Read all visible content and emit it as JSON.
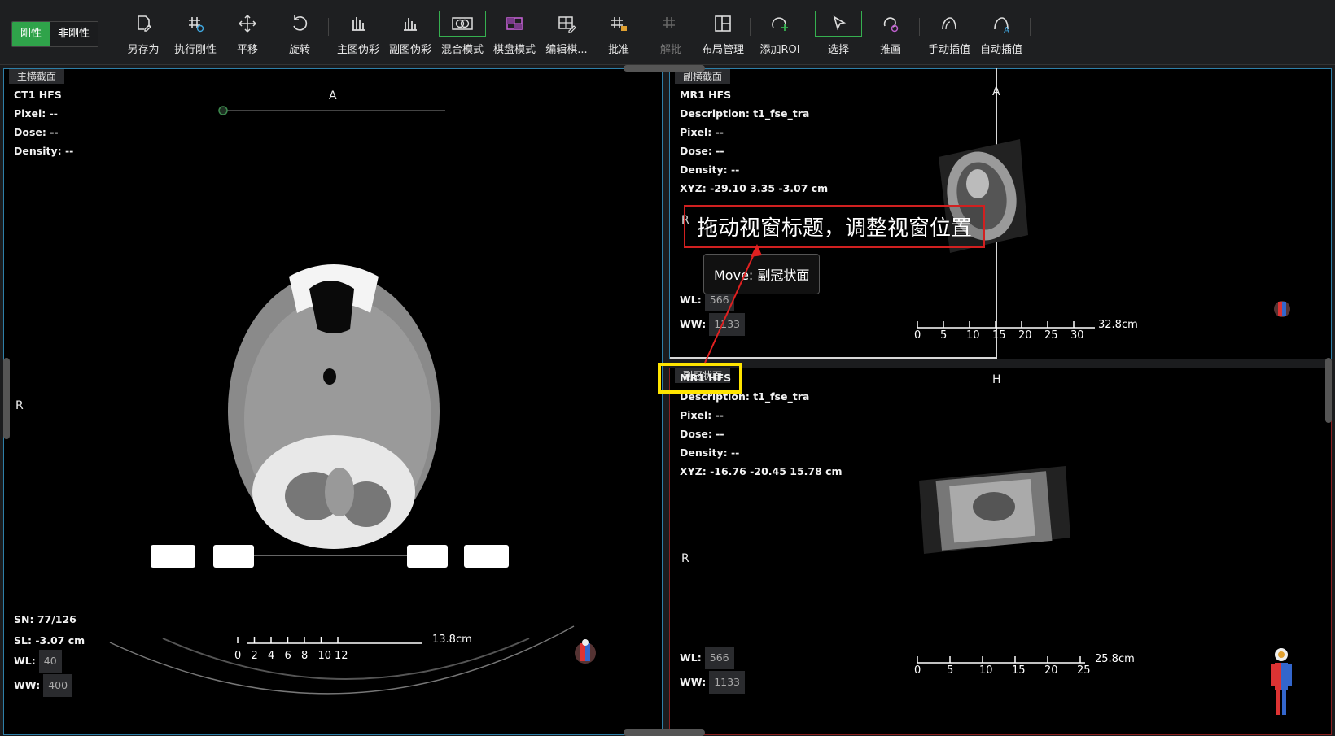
{
  "toolbar": {
    "mode_rigid": "刚性",
    "mode_nonrigid": "非刚性",
    "tools": [
      {
        "label": "另存为",
        "icon": "save-as-icon"
      },
      {
        "label": "执行刚性",
        "icon": "execute-rigid-icon"
      },
      {
        "label": "平移",
        "icon": "pan-icon"
      },
      {
        "label": "旋转",
        "icon": "rotate-icon"
      },
      {
        "label": "主图伪彩",
        "icon": "primary-pseudocolor-icon"
      },
      {
        "label": "副图伪彩",
        "icon": "secondary-pseudocolor-icon"
      },
      {
        "label": "混合模式",
        "icon": "blend-mode-icon"
      },
      {
        "label": "棋盘模式",
        "icon": "checkerboard-mode-icon"
      },
      {
        "label": "编辑棋...",
        "icon": "edit-checkerboard-icon"
      },
      {
        "label": "批准",
        "icon": "approve-icon"
      },
      {
        "label": "解批",
        "icon": "unapprove-icon"
      },
      {
        "label": "布局管理",
        "icon": "layout-icon"
      },
      {
        "label": "添加ROI",
        "icon": "add-roi-icon"
      },
      {
        "label": "选择",
        "icon": "select-icon"
      },
      {
        "label": "推画",
        "icon": "push-draw-icon"
      },
      {
        "label": "手动插值",
        "icon": "manual-interp-icon"
      },
      {
        "label": "自动插值",
        "icon": "auto-interp-icon"
      }
    ]
  },
  "main_view": {
    "tab": "主横截面",
    "modality": "CT1 HFS",
    "pixel": "Pixel:  --",
    "dose": "Dose:  --",
    "density": "Density:  --",
    "orient_top": "A",
    "orient_left": "R",
    "sn": "SN: 77/126",
    "sl": "SL: -3.07 cm",
    "wl_label": "WL:",
    "wl_value": "40",
    "ww_label": "WW:",
    "ww_value": "400",
    "scale_ticks": [
      "0",
      "2",
      "4",
      "6",
      "8",
      "10",
      "12"
    ],
    "scale_label": "13.8cm"
  },
  "upper_view": {
    "tab": "副横截面",
    "modality": "MR1 HFS",
    "description": "Description:  t1_fse_tra",
    "pixel": "Pixel:  --",
    "dose": "Dose:  --",
    "density": "Density:  --",
    "xyz": "XYZ: -29.10 3.35 -3.07 cm",
    "orient_top": "A",
    "orient_left": "R",
    "wl_label": "WL:",
    "wl_value": "566",
    "ww_label": "WW:",
    "ww_value": "1133",
    "scale_ticks": [
      "0",
      "5",
      "10",
      "15",
      "20",
      "25",
      "30"
    ],
    "scale_label": "32.8cm"
  },
  "lower_view": {
    "tab": "副冠状面",
    "modality": "MR1 HFS",
    "description": "Description:  t1_fse_tra",
    "pixel": "Pixel:  --",
    "dose": "Dose:  --",
    "density": "Density:  --",
    "xyz": "XYZ: -16.76 -20.45 15.78 cm",
    "orient_top": "H",
    "orient_left": "R",
    "wl_label": "WL:",
    "wl_value": "566",
    "ww_label": "WW:",
    "ww_value": "1133",
    "scale_ticks": [
      "0",
      "5",
      "10",
      "15",
      "20",
      "25"
    ],
    "scale_label": "25.8cm"
  },
  "annotation": {
    "text": "拖动视窗标题，调整视窗位置",
    "tooltip": "Move: 副冠状面"
  },
  "colors": {
    "accent_green": "#2fa34a",
    "annotation_red": "#d12020",
    "highlight_yellow": "#ffe400",
    "panel_border_blue": "#2e7fa8",
    "panel_border_red": "#8a2020"
  }
}
